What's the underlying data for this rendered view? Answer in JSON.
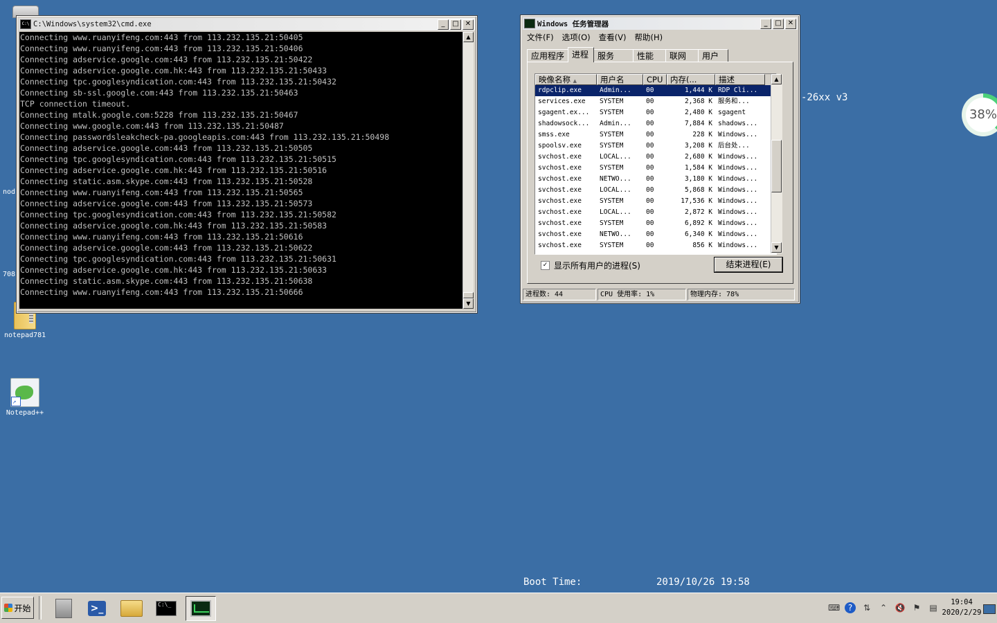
{
  "desktop": {
    "icons": [
      {
        "label": "notepad781"
      },
      {
        "label": "Notepad++"
      }
    ],
    "partial_labels": [
      "nod",
      "708"
    ],
    "bginfo": {
      "version_fragment": "-26xx v3",
      "boot_label": "Boot Time:",
      "boot_value": "2019/10/26 19:58"
    },
    "net_monitor": {
      "percent_text": "38%",
      "value": 38
    }
  },
  "cmd_window": {
    "title": "C:\\Windows\\system32\\cmd.exe",
    "lines": [
      "Connecting www.ruanyifeng.com:443 from 113.232.135.21:50405",
      "Connecting www.ruanyifeng.com:443 from 113.232.135.21:50406",
      "Connecting adservice.google.com:443 from 113.232.135.21:50422",
      "Connecting adservice.google.com.hk:443 from 113.232.135.21:50433",
      "Connecting tpc.googlesyndication.com:443 from 113.232.135.21:50432",
      "Connecting sb-ssl.google.com:443 from 113.232.135.21:50463",
      "TCP connection timeout.",
      "Connecting mtalk.google.com:5228 from 113.232.135.21:50467",
      "Connecting www.google.com:443 from 113.232.135.21:50487",
      "Connecting passwordsleakcheck-pa.googleapis.com:443 from 113.232.135.21:50498",
      "Connecting adservice.google.com:443 from 113.232.135.21:50505",
      "Connecting tpc.googlesyndication.com:443 from 113.232.135.21:50515",
      "Connecting adservice.google.com.hk:443 from 113.232.135.21:50516",
      "Connecting static.asm.skype.com:443 from 113.232.135.21:50528",
      "Connecting www.ruanyifeng.com:443 from 113.232.135.21:50565",
      "Connecting adservice.google.com:443 from 113.232.135.21:50573",
      "Connecting tpc.googlesyndication.com:443 from 113.232.135.21:50582",
      "Connecting adservice.google.com.hk:443 from 113.232.135.21:50583",
      "Connecting www.ruanyifeng.com:443 from 113.232.135.21:50616",
      "Connecting adservice.google.com:443 from 113.232.135.21:50622",
      "Connecting tpc.googlesyndication.com:443 from 113.232.135.21:50631",
      "Connecting adservice.google.com.hk:443 from 113.232.135.21:50633",
      "Connecting static.asm.skype.com:443 from 113.232.135.21:50638",
      "Connecting www.ruanyifeng.com:443 from 113.232.135.21:50666"
    ]
  },
  "task_manager": {
    "title": "Windows 任务管理器",
    "menu": [
      "文件(F)",
      "选项(O)",
      "查看(V)",
      "帮助(H)"
    ],
    "tabs": [
      "应用程序",
      "进程",
      "服务",
      "性能",
      "联网",
      "用户"
    ],
    "selected_tab": "进程",
    "columns": [
      "映像名称",
      "用户名",
      "CPU",
      "内存(...",
      "描述"
    ],
    "rows": [
      {
        "name": "rdpclip.exe",
        "user": "Admin...",
        "cpu": "00",
        "mem": "1,444 K",
        "desc": "RDP Cli...",
        "selected": true
      },
      {
        "name": "services.exe",
        "user": "SYSTEM",
        "cpu": "00",
        "mem": "2,368 K",
        "desc": "服务和..."
      },
      {
        "name": "sgagent.ex...",
        "user": "SYSTEM",
        "cpu": "00",
        "mem": "2,480 K",
        "desc": "sgagent"
      },
      {
        "name": "shadowsock...",
        "user": "Admin...",
        "cpu": "00",
        "mem": "7,884 K",
        "desc": "shadows..."
      },
      {
        "name": "smss.exe",
        "user": "SYSTEM",
        "cpu": "00",
        "mem": "228 K",
        "desc": "Windows..."
      },
      {
        "name": "spoolsv.exe",
        "user": "SYSTEM",
        "cpu": "00",
        "mem": "3,208 K",
        "desc": "后台处..."
      },
      {
        "name": "svchost.exe",
        "user": "LOCAL...",
        "cpu": "00",
        "mem": "2,680 K",
        "desc": "Windows..."
      },
      {
        "name": "svchost.exe",
        "user": "SYSTEM",
        "cpu": "00",
        "mem": "1,584 K",
        "desc": "Windows..."
      },
      {
        "name": "svchost.exe",
        "user": "NETWO...",
        "cpu": "00",
        "mem": "3,180 K",
        "desc": "Windows..."
      },
      {
        "name": "svchost.exe",
        "user": "LOCAL...",
        "cpu": "00",
        "mem": "5,868 K",
        "desc": "Windows..."
      },
      {
        "name": "svchost.exe",
        "user": "SYSTEM",
        "cpu": "00",
        "mem": "17,536 K",
        "desc": "Windows..."
      },
      {
        "name": "svchost.exe",
        "user": "LOCAL...",
        "cpu": "00",
        "mem": "2,872 K",
        "desc": "Windows..."
      },
      {
        "name": "svchost.exe",
        "user": "SYSTEM",
        "cpu": "00",
        "mem": "6,892 K",
        "desc": "Windows..."
      },
      {
        "name": "svchost.exe",
        "user": "NETWO...",
        "cpu": "00",
        "mem": "6,340 K",
        "desc": "Windows..."
      },
      {
        "name": "svchost.exe",
        "user": "SYSTEM",
        "cpu": "00",
        "mem": "856 K",
        "desc": "Windows..."
      }
    ],
    "show_all_label": "显示所有用户的进程(S)",
    "show_all_checked": true,
    "end_process_label": "结束进程(E)",
    "status": {
      "processes": "进程数: 44",
      "cpu": "CPU 使用率: 1%",
      "memory": "物理内存: 78%"
    }
  },
  "taskbar": {
    "start_label": "开始",
    "clock_time": "19:04",
    "clock_date": "2020/2/29"
  }
}
